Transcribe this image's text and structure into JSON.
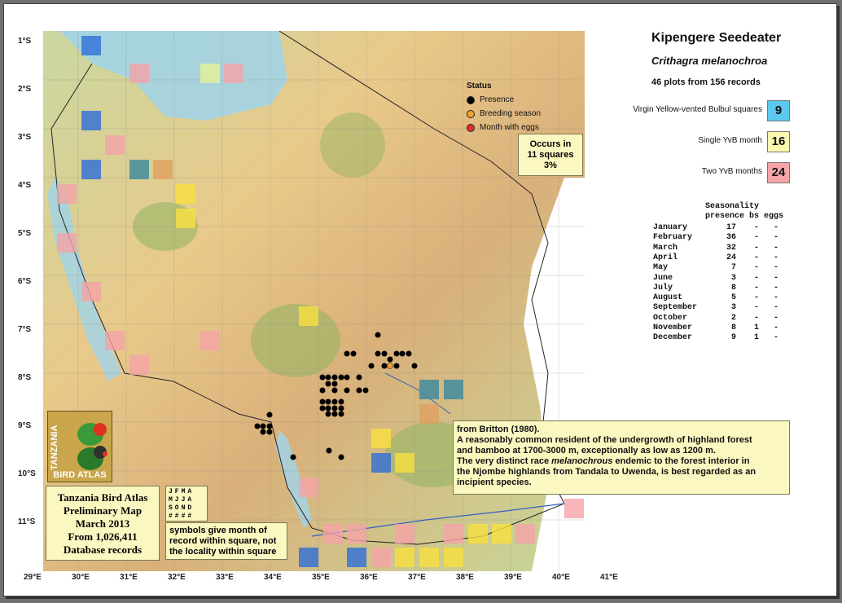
{
  "title": "Kipengere Seedeater",
  "scientific_name": "Crithagra melanochroa",
  "plots_summary": "46 plots from 156 records",
  "legend": [
    {
      "label": "Virgin Yellow-vented Bulbul squares",
      "value": "9",
      "color": "#5bc8ef"
    },
    {
      "label": "Single YvB month",
      "value": "16",
      "color": "#fbf7b0"
    },
    {
      "label": "Two YvB months",
      "value": "24",
      "color": "#f5a4a8"
    }
  ],
  "status": {
    "heading": "Status",
    "items": [
      {
        "label": "Presence",
        "color": "#000000"
      },
      {
        "label": "Breeding season",
        "color": "#f0a030"
      },
      {
        "label": "Month with eggs",
        "color": "#e03030"
      }
    ]
  },
  "occurs": {
    "line1": "Occurs in",
    "line2": "11 squares",
    "line3": "3%"
  },
  "seasonality": {
    "heading1": "Seasonality",
    "heading2": "presence bs eggs",
    "rows": [
      {
        "month": "January",
        "presence": "17",
        "bs": "-",
        "eggs": "-"
      },
      {
        "month": "February",
        "presence": "36",
        "bs": "-",
        "eggs": "-"
      },
      {
        "month": "March",
        "presence": "32",
        "bs": "-",
        "eggs": "-"
      },
      {
        "month": "April",
        "presence": "24",
        "bs": "-",
        "eggs": "-"
      },
      {
        "month": "May",
        "presence": "7",
        "bs": "-",
        "eggs": "-"
      },
      {
        "month": "June",
        "presence": "3",
        "bs": "-",
        "eggs": "-"
      },
      {
        "month": "July",
        "presence": "8",
        "bs": "-",
        "eggs": "-"
      },
      {
        "month": "August",
        "presence": "5",
        "bs": "-",
        "eggs": "-"
      },
      {
        "month": "September",
        "presence": "3",
        "bs": "-",
        "eggs": "-"
      },
      {
        "month": "October",
        "presence": "2",
        "bs": "-",
        "eggs": "-"
      },
      {
        "month": "November",
        "presence": "8",
        "bs": "1",
        "eggs": "-"
      },
      {
        "month": "December",
        "presence": "9",
        "bs": "1",
        "eggs": "-"
      }
    ]
  },
  "britton_note": {
    "line1": "from Britton (1980).",
    "line2": "A reasonably common resident of the undergrowth of highland forest",
    "line3": "and bamboo at 1700-3000 m, exceptionally as low as 1200 m.",
    "line4_pre": "The very distinct race ",
    "line4_em": "melanochrous",
    "line4_post": " endemic to the forest interior in",
    "line5": "the Njombe highlands from Tandala to Uwenda, is best regarded as an",
    "line6": "incipient species."
  },
  "prelim": {
    "line1": "Tanzania Bird Atlas",
    "line2": "Preliminary Map",
    "line3": "March 2013",
    "line4": "From 1,026,411",
    "line5": "Database records"
  },
  "month_grid": [
    "JFMA",
    "MJJA",
    "SOND",
    "####"
  ],
  "symbol_note": "symbols give month of record within square, not the locality within square",
  "logo": {
    "vertical": "TANZANIA",
    "bottom": "BIRD ATLAS"
  },
  "lat_labels": [
    "1°S",
    "2°S",
    "3°S",
    "4°S",
    "5°S",
    "6°S",
    "7°S",
    "8°S",
    "9°S",
    "10°S",
    "11°S"
  ],
  "lon_labels": [
    "29°E",
    "30°E",
    "31°E",
    "32°E",
    "33°E",
    "34°E",
    "35°E",
    "36°E",
    "37°E",
    "38°E",
    "39°E",
    "40°E",
    "41°E"
  ]
}
